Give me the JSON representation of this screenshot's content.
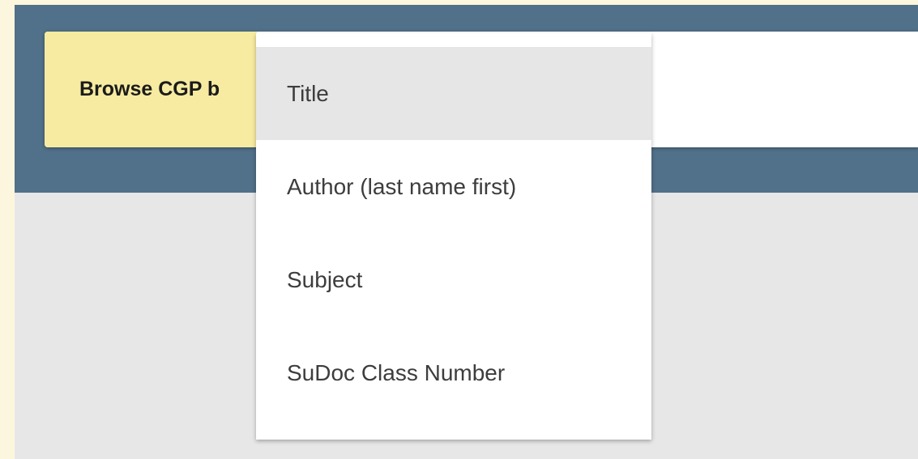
{
  "browse": {
    "label": "Browse CGP b"
  },
  "dropdown": {
    "options": [
      {
        "label": "Title",
        "selected": true
      },
      {
        "label": "Author (last name first)",
        "selected": false
      },
      {
        "label": "Subject",
        "selected": false
      },
      {
        "label": "SuDoc Class Number",
        "selected": false
      }
    ]
  },
  "colors": {
    "page_background": "#fdf6de",
    "header_band": "#517089",
    "content_background": "#e7e7e7",
    "label_highlight": "#f7eba1",
    "selected_option": "#e6e6e6"
  }
}
